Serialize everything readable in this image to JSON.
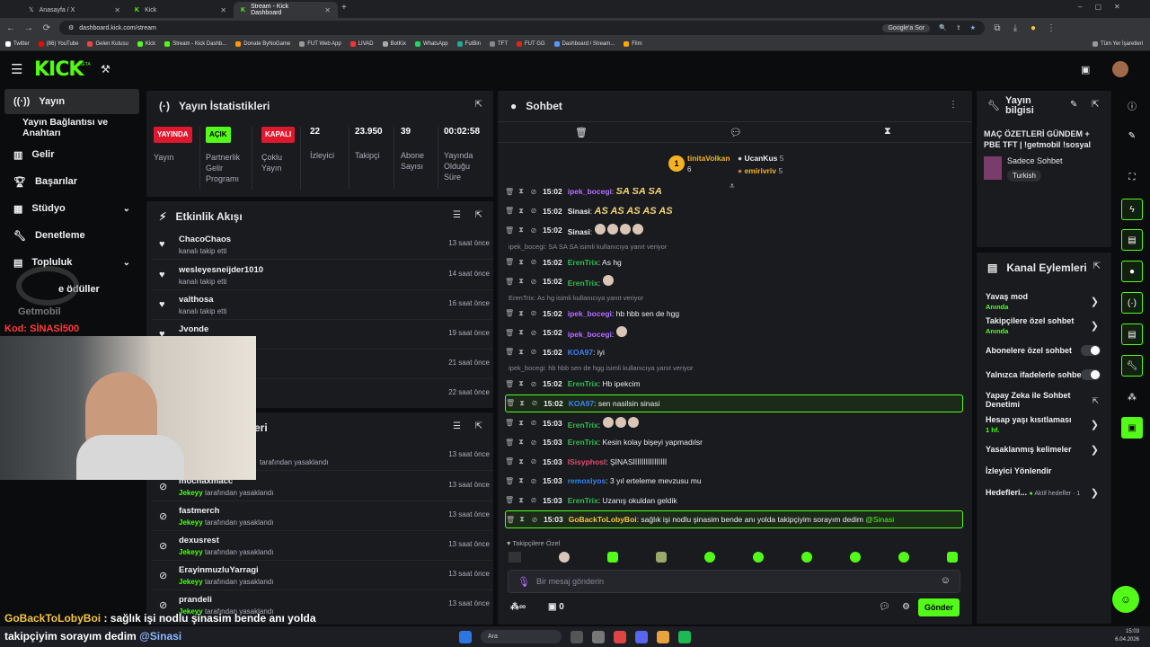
{
  "browser": {
    "tabs": [
      {
        "label": "Anasayfa / X",
        "active": false
      },
      {
        "label": "Kick",
        "active": false
      },
      {
        "label": "Stream - Kick Dashboard",
        "active": true
      }
    ],
    "url": "dashboard.kick.com/stream",
    "search_engine": "Google'a Sor",
    "bookmarks": [
      "Twitter",
      "(86) YouTube",
      "Gelen Kutusu",
      "Kick",
      "Stream - Kick Dashb...",
      "Donate ByNoGame",
      "FUT Web App",
      "LIVAD",
      "BotKix",
      "WhatsApp",
      "FutBin",
      "TFT",
      "FUT GG",
      "Dashboard / Stream...",
      "Film"
    ],
    "all_bookmarks": "Tüm Yer İşaretleri"
  },
  "app": {
    "logo": "KICK",
    "logo_tag": "BETA",
    "accent": "#53fc18"
  },
  "sidebar": {
    "items": [
      {
        "label": "Yayın",
        "icon": "broadcast-icon",
        "active": true
      },
      {
        "label": "Yayın Bağlantısı ve Anahtarı",
        "icon": "",
        "active": false
      },
      {
        "label": "Gelir",
        "icon": "chart-icon",
        "active": false
      },
      {
        "label": "Başarılar",
        "icon": "trophy-icon",
        "active": false
      },
      {
        "label": "Stüdyo",
        "icon": "studio-icon",
        "active": false
      },
      {
        "label": "Denetleme",
        "icon": "wrench-icon",
        "active": false
      },
      {
        "label": "Topluluk",
        "icon": "community-icon",
        "active": false
      },
      {
        "label": "e ödüller",
        "icon": "gift-icon",
        "active": false
      }
    ]
  },
  "overlay": {
    "watermark": "Getmobil",
    "code": "Kod: SİNASİ500",
    "caption_user": "GoBackToLobyBoi",
    "caption_line1": ": sağlık işi nodlu şinasim bende anı yolda",
    "caption_line2": "takipçiyim sorayım dedim",
    "caption_mention": "@Sinasi"
  },
  "stats": {
    "title": "Yayın İstatistikleri",
    "items": [
      {
        "badge": "YAYINDA",
        "badge_color": "#e0182d",
        "label": "Yayın"
      },
      {
        "badge": "AÇIK",
        "badge_color": "#53fc18",
        "label": "Partnerlik Gelir Programı"
      },
      {
        "badge": "KAPALI",
        "badge_color": "#e0182d",
        "label": "Çoklu Yayın"
      },
      {
        "value": "22",
        "label": "İzleyici"
      },
      {
        "value": "23.950",
        "label": "Takipçi"
      },
      {
        "value": "39",
        "label": "Abone Sayısı"
      },
      {
        "value": "00:02:58",
        "label": "Yayında Olduğu Süre"
      }
    ]
  },
  "activity": {
    "title": "Etkinlik Akışı",
    "rows": [
      {
        "name": "ChacoChaos",
        "sub": "kanalı takip etti",
        "time": "13 saat önce"
      },
      {
        "name": "wesleyesneijder1010",
        "sub": "kanalı takip etti",
        "time": "14 saat önce"
      },
      {
        "name": "valthosa",
        "sub": "kanalı takip etti",
        "time": "16 saat önce"
      },
      {
        "name": "Jvonde",
        "sub": "",
        "time": "19 saat önce"
      },
      {
        "name": "",
        "sub": "",
        "time": "21 saat önce"
      },
      {
        "name": "",
        "sub": "",
        "time": "22 saat önce"
      }
    ]
  },
  "bans": {
    "title": "eri",
    "by_user": "Jekeyy",
    "by_text": "tarafından yasaklandı",
    "rows": [
      {
        "name": "",
        "time": "13 saat önce"
      },
      {
        "name": "mochaxmacc",
        "time": "13 saat önce"
      },
      {
        "name": "fastmerch",
        "time": "13 saat önce"
      },
      {
        "name": "dexusrest",
        "time": "13 saat önce"
      },
      {
        "name": "ErayinmuzluYarragi",
        "time": "13 saat önce"
      },
      {
        "name": "prandeli",
        "time": "13 saat önce"
      }
    ]
  },
  "chat": {
    "title": "Sohbet",
    "leaderboard": [
      {
        "name": "tinitaVolkan",
        "count": "6",
        "rank": "1"
      },
      {
        "name": "UcanKus",
        "count": "5"
      },
      {
        "name": "emirivriv",
        "count": "5"
      }
    ],
    "messages": [
      {
        "type": "msg",
        "time": "15:02",
        "user": "ipek_bocegi",
        "color": "#b86bff",
        "text": "SA SA SA",
        "emote": true
      },
      {
        "type": "msg",
        "time": "15:02",
        "user": "Sinasi",
        "color": "#eeeeee",
        "text": "AS AS AS AS AS",
        "emote": true
      },
      {
        "type": "msg",
        "time": "15:02",
        "user": "Sinasi",
        "color": "#eeeeee",
        "text": "",
        "faces": 4
      },
      {
        "type": "reply",
        "text": "ipek_bocegi: SA SA SA isimli kullanıcıya yanıt veriyor"
      },
      {
        "type": "msg",
        "time": "15:02",
        "user": "ErenTrix",
        "color": "#2fbf4f",
        "text": "As hg"
      },
      {
        "type": "msg",
        "time": "15:02",
        "user": "ErenTrix",
        "color": "#2fbf4f",
        "text": "",
        "faces": 1
      },
      {
        "type": "reply",
        "text": "ErenTrix: As hg isimli kullanıcıya yanıt veriyor"
      },
      {
        "type": "msg",
        "time": "15:02",
        "user": "ipek_bocegi",
        "color": "#b86bff",
        "text": "hb hbb sen de hgg"
      },
      {
        "type": "msg",
        "time": "15:02",
        "user": "ipek_bocegi",
        "color": "#b86bff",
        "text": "",
        "faces": 1
      },
      {
        "type": "msg",
        "time": "15:02",
        "user": "KOA97",
        "color": "#3b82f6",
        "text": "iyi"
      },
      {
        "type": "reply",
        "text": "ipek_bocegi: hb hbb sen de hgg isimli kullanıcıya yanıt veriyor"
      },
      {
        "type": "msg",
        "time": "15:02",
        "user": "ErenTrix",
        "color": "#2fbf4f",
        "text": "Hb ipekcim"
      },
      {
        "type": "msg",
        "time": "15:02",
        "user": "KOA97",
        "color": "#3b82f6",
        "text": "sen nasilsin sinasi",
        "hl": true
      },
      {
        "type": "msg",
        "time": "15:03",
        "user": "ErenTrix",
        "color": "#2fbf4f",
        "text": "",
        "faces": 3
      },
      {
        "type": "msg",
        "time": "15:03",
        "user": "ErenTrix",
        "color": "#2fbf4f",
        "text": "Kesin kolay bişeyi yapmadılsr"
      },
      {
        "type": "msg",
        "time": "15:03",
        "user": "ISisyphosI",
        "color": "#e24b6b",
        "text": "ŞİNASİİİİİİİİİİİİİİİİ"
      },
      {
        "type": "msg",
        "time": "15:03",
        "user": "remoxiyos",
        "color": "#3b82f6",
        "text": "3 yıl erteleme mevzusu mu"
      },
      {
        "type": "msg",
        "time": "15:03",
        "user": "ErenTrix",
        "color": "#2fbf4f",
        "text": "Uzanış okuldan geldik"
      },
      {
        "type": "msg",
        "time": "15:03",
        "user": "GoBackToLobyBoi",
        "color": "#f5c542",
        "text": "sağlık işi nodlu şinasim bende anı yolda takipçiyim sorayım dedim",
        "mention": "@Sinasi",
        "hl": true
      }
    ],
    "followers_only": "Takipçilere Özel",
    "input_placeholder": "Bir mesaj gönderin",
    "send": "Gönder",
    "points": "0"
  },
  "stream_info": {
    "title": "Yayın bilgisi",
    "stream_title": "MAÇ ÖZETLERİ GÜNDEM + PBE TFT | !getmobil !sosyal",
    "category": "Sadece Sohbet",
    "language": "Turkish"
  },
  "channel_actions": {
    "title": "Kanal Eylemleri",
    "items": [
      {
        "label": "Yavaş mod",
        "sub": "Anında",
        "control": "arrow"
      },
      {
        "label": "Takipçilere özel sohbet",
        "sub": "Anında",
        "control": "arrow"
      },
      {
        "label": "Abonelere özel sohbet",
        "sub": "",
        "control": "toggle"
      },
      {
        "label": "Yalnızca ifadelerle sohbet",
        "sub": "",
        "control": "toggle"
      },
      {
        "label": "Yapay Zeka ile Sohbet Denetimi",
        "sub": "",
        "control": "external"
      },
      {
        "label": "Hesap yaşı kısıtlaması",
        "sub": "1 hf.",
        "control": "arrow"
      },
      {
        "label": "Yasaklanmış kelimeler",
        "sub": "",
        "control": "arrow"
      },
      {
        "label": "İzleyici Yönlendir",
        "sub": "",
        "control": "none"
      },
      {
        "label": "Hedefleri...",
        "sub": "Aktif hedefler · 1",
        "control": "arrow"
      }
    ]
  },
  "taskbar": {
    "search": "Ara",
    "time": "15:03",
    "date": "6.04.2026"
  }
}
